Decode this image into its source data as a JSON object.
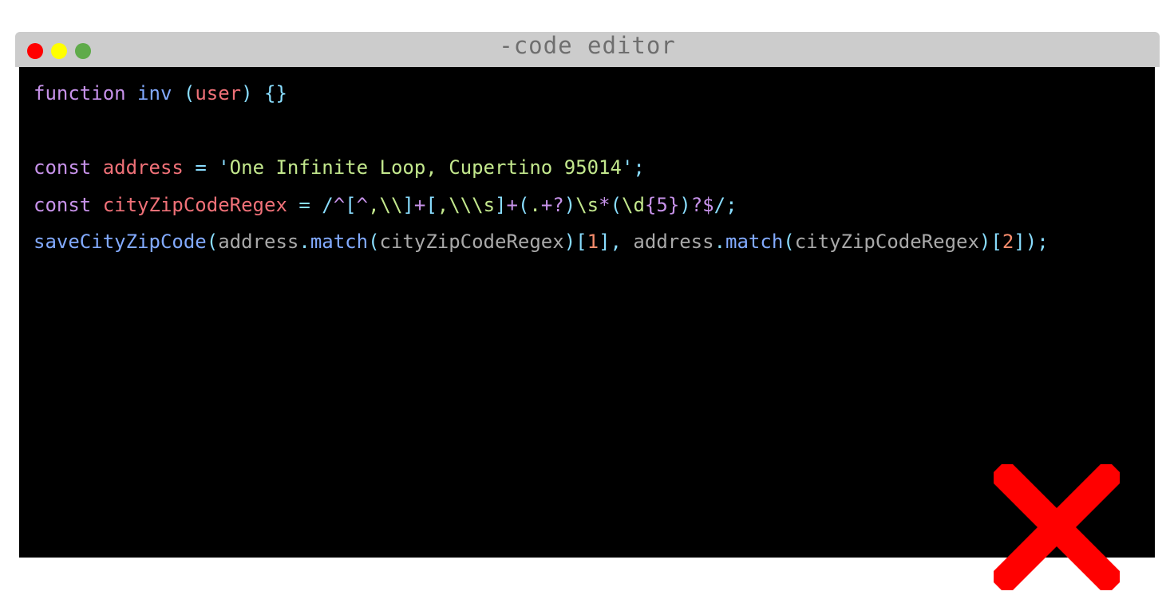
{
  "window": {
    "title": "-code editor",
    "controls": [
      {
        "name": "close-dot",
        "color": "#ff0000"
      },
      {
        "name": "minimize-dot",
        "color": "#ffff00"
      },
      {
        "name": "maximize-dot",
        "color": "#5fab4a"
      }
    ]
  },
  "editor": {
    "lines": [
      [
        {
          "t": "function",
          "c": "#c792ea"
        },
        {
          "t": " ",
          "c": "#ffffff"
        },
        {
          "t": "inv",
          "c": "#82aaff"
        },
        {
          "t": " ",
          "c": "#ffffff"
        },
        {
          "t": "(",
          "c": "#89ddff"
        },
        {
          "t": "user",
          "c": "#f07178"
        },
        {
          "t": ")",
          "c": "#89ddff"
        },
        {
          "t": " ",
          "c": "#ffffff"
        },
        {
          "t": "{}",
          "c": "#89ddff"
        }
      ],
      [],
      [
        {
          "t": "const",
          "c": "#c792ea"
        },
        {
          "t": " ",
          "c": "#ffffff"
        },
        {
          "t": "address",
          "c": "#f07178"
        },
        {
          "t": " ",
          "c": "#ffffff"
        },
        {
          "t": "=",
          "c": "#89ddff"
        },
        {
          "t": " ",
          "c": "#ffffff"
        },
        {
          "t": "'",
          "c": "#89ddff"
        },
        {
          "t": "One Infinite Loop, Cupertino 95014",
          "c": "#c3e88d"
        },
        {
          "t": "'",
          "c": "#89ddff"
        },
        {
          "t": ";",
          "c": "#89ddff"
        }
      ],
      [
        {
          "t": "const",
          "c": "#c792ea"
        },
        {
          "t": " ",
          "c": "#ffffff"
        },
        {
          "t": "cityZipCodeRegex",
          "c": "#f07178"
        },
        {
          "t": " ",
          "c": "#ffffff"
        },
        {
          "t": "=",
          "c": "#89ddff"
        },
        {
          "t": " ",
          "c": "#ffffff"
        },
        {
          "t": "/",
          "c": "#89ddff"
        },
        {
          "t": "^",
          "c": "#c792ea"
        },
        {
          "t": "[",
          "c": "#89ddff"
        },
        {
          "t": "^",
          "c": "#c792ea"
        },
        {
          "t": ",\\\\",
          "c": "#c3e88d"
        },
        {
          "t": "]",
          "c": "#89ddff"
        },
        {
          "t": "+",
          "c": "#c792ea"
        },
        {
          "t": "[",
          "c": "#89ddff"
        },
        {
          "t": ",\\\\\\s",
          "c": "#c3e88d"
        },
        {
          "t": "]",
          "c": "#89ddff"
        },
        {
          "t": "+",
          "c": "#c792ea"
        },
        {
          "t": "(",
          "c": "#89ddff"
        },
        {
          "t": ".",
          "c": "#c3e88d"
        },
        {
          "t": "+?",
          "c": "#c792ea"
        },
        {
          "t": ")",
          "c": "#89ddff"
        },
        {
          "t": "\\s",
          "c": "#c3e88d"
        },
        {
          "t": "*",
          "c": "#c792ea"
        },
        {
          "t": "(",
          "c": "#89ddff"
        },
        {
          "t": "\\d",
          "c": "#c3e88d"
        },
        {
          "t": "{5}",
          "c": "#c792ea"
        },
        {
          "t": ")",
          "c": "#89ddff"
        },
        {
          "t": "?$",
          "c": "#c792ea"
        },
        {
          "t": "/",
          "c": "#89ddff"
        },
        {
          "t": ";",
          "c": "#89ddff"
        }
      ],
      [
        {
          "t": "saveCityZipCode",
          "c": "#82aaff"
        },
        {
          "t": "(",
          "c": "#89ddff"
        },
        {
          "t": "address",
          "c": "#a9a9a9"
        },
        {
          "t": ".",
          "c": "#89ddff"
        },
        {
          "t": "match",
          "c": "#82aaff"
        },
        {
          "t": "(",
          "c": "#89ddff"
        },
        {
          "t": "cityZipCodeRegex",
          "c": "#a9a9a9"
        },
        {
          "t": ")",
          "c": "#89ddff"
        },
        {
          "t": "[",
          "c": "#89ddff"
        },
        {
          "t": "1",
          "c": "#f78c6c"
        },
        {
          "t": "]",
          "c": "#89ddff"
        },
        {
          "t": ",",
          "c": "#89ddff"
        },
        {
          "t": " ",
          "c": "#ffffff"
        },
        {
          "t": "address",
          "c": "#a9a9a9"
        },
        {
          "t": ".",
          "c": "#89ddff"
        },
        {
          "t": "match",
          "c": "#82aaff"
        },
        {
          "t": "(",
          "c": "#89ddff"
        },
        {
          "t": "cityZipCodeRegex",
          "c": "#a9a9a9"
        },
        {
          "t": ")",
          "c": "#89ddff"
        },
        {
          "t": "[",
          "c": "#89ddff"
        },
        {
          "t": "2",
          "c": "#f78c6c"
        },
        {
          "t": "]",
          "c": "#89ddff"
        },
        {
          "t": ")",
          "c": "#89ddff"
        },
        {
          "t": ";",
          "c": "#89ddff"
        }
      ]
    ]
  },
  "overlay": {
    "icon": "cross-icon",
    "color": "#ff0000"
  }
}
